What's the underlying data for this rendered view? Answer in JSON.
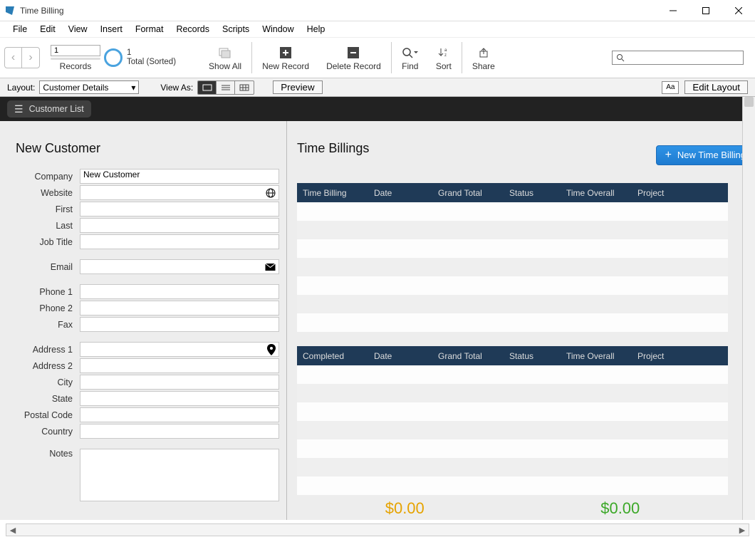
{
  "window": {
    "title": "Time Billing"
  },
  "menu": {
    "file": "File",
    "edit": "Edit",
    "view": "View",
    "insert": "Insert",
    "format": "Format",
    "records": "Records",
    "scripts": "Scripts",
    "window": "Window",
    "help": "Help"
  },
  "toolbar": {
    "record_number": "1",
    "records_label": "Records",
    "found_count": "1",
    "found_text": "Total (Sorted)",
    "show_all": "Show All",
    "new_record": "New Record",
    "delete_record": "Delete Record",
    "find": "Find",
    "sort": "Sort",
    "share": "Share"
  },
  "layoutbar": {
    "layout_label": "Layout:",
    "layout_value": "Customer Details",
    "view_as_label": "View As:",
    "preview": "Preview",
    "aa": "Aa",
    "edit_layout": "Edit Layout"
  },
  "darkband": {
    "customer_list": "Customer List"
  },
  "left": {
    "title": "New Customer",
    "labels": {
      "company": "Company",
      "website": "Website",
      "first": "First",
      "last": "Last",
      "job_title": "Job Title",
      "email": "Email",
      "phone1": "Phone 1",
      "phone2": "Phone 2",
      "fax": "Fax",
      "address1": "Address 1",
      "address2": "Address 2",
      "city": "City",
      "state": "State",
      "postal": "Postal Code",
      "country": "Country",
      "notes": "Notes"
    },
    "values": {
      "company": "New Customer"
    }
  },
  "right": {
    "title": "Time Billings",
    "new_button": "New Time Billing",
    "table1_headers": {
      "c1": "Time Billing",
      "c2": "Date",
      "c3": "Grand Total",
      "c4": "Status",
      "c5": "Time Overall",
      "c6": "Project"
    },
    "table2_headers": {
      "c1": "Completed",
      "c2": "Date",
      "c3": "Grand Total",
      "c4": "Status",
      "c5": "Time Overall",
      "c6": "Project"
    },
    "total_zero": "$0.00"
  }
}
